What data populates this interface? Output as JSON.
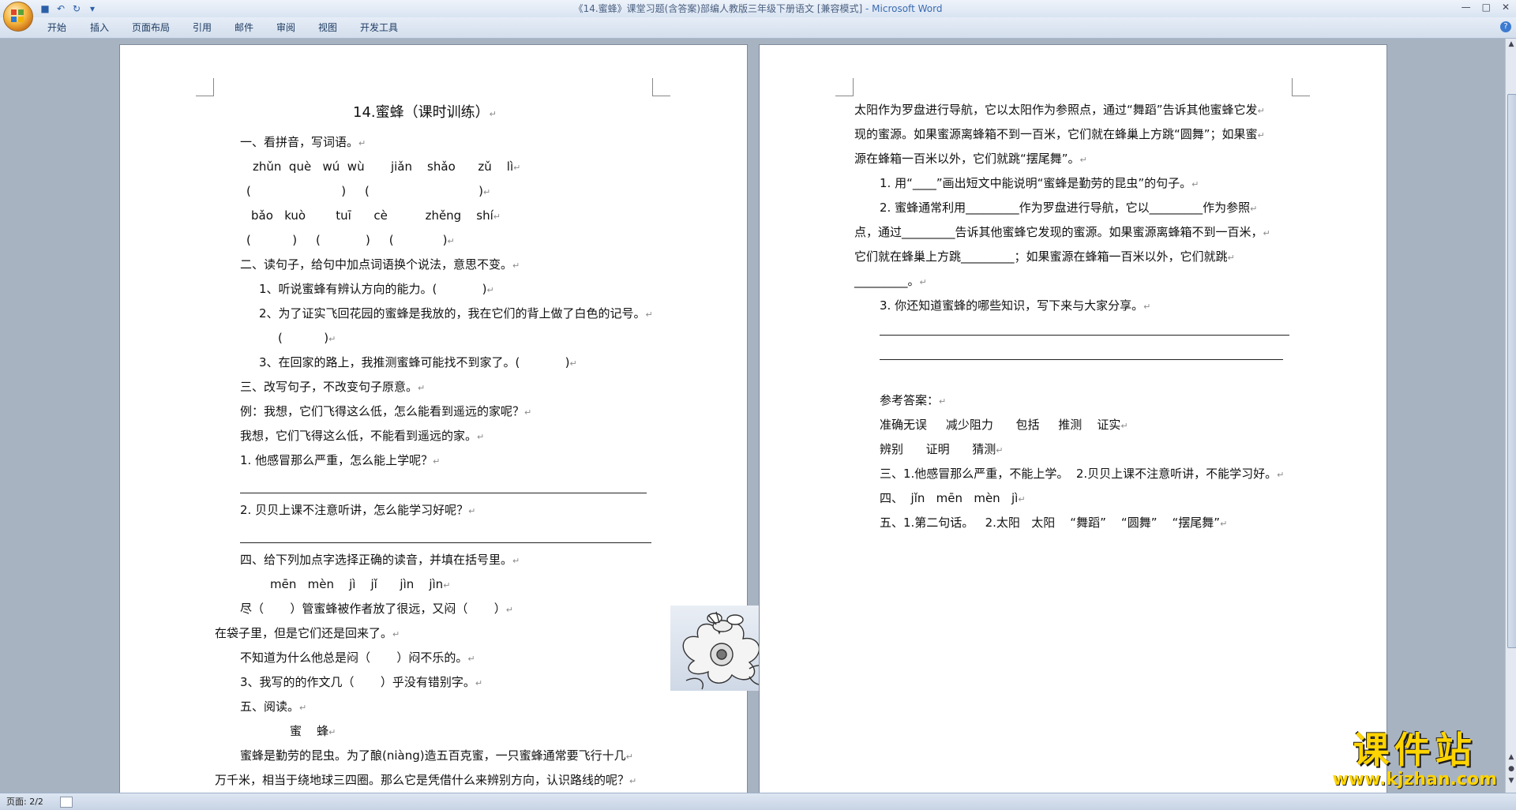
{
  "window": {
    "title": "《14.蜜蜂》课堂习题(含答案)部编人教版三年级下册语文 [兼容模式]",
    "app": " - Microsoft Word",
    "controls": [
      "—",
      "□",
      "✕"
    ]
  },
  "quick_access": [
    {
      "icon": "save-icon",
      "glyph": "■"
    },
    {
      "icon": "undo-icon",
      "glyph": "↶"
    },
    {
      "icon": "redo-icon",
      "glyph": "↻"
    },
    {
      "icon": "customize-icon",
      "glyph": "▾"
    }
  ],
  "ribbon": {
    "tabs": [
      "开始",
      "插入",
      "页面布局",
      "引用",
      "邮件",
      "审阅",
      "视图",
      "开发工具"
    ]
  },
  "page1": {
    "heading": "14.蜜蜂（课时训练）",
    "s1": "一、看拼音，写词语。",
    "py1": "zhǔn  què   wú  wù       jiǎn    shǎo      zǔ    lì",
    "br1": "(                        )     (                             )",
    "py2": "bǎo   kuò        tuī      cè          zhěng    shí",
    "br2": "(           )     (            )     (             )",
    "s2": "二、读句子，给句中加点词语换个说法，意思不变。",
    "s2_1": "1、听说蜜蜂有辨认方向的能力。(            )",
    "s2_2": "2、为了证实飞回花园的蜜蜂是我放的，我在它们的背上做了白色的记号。",
    "s2_2b": "(           )",
    "s2_3": "3、在回家的路上，我推测蜜蜂可能找不到家了。(            )",
    "s3": "三、改写句子，不改变句子原意。",
    "s3_ex": "例：我想，它们飞得这么低，怎么能看到遥远的家呢？",
    "s3_ex2": "我想，它们飞得这么低，不能看到遥远的家。",
    "s3_1": "1. 他感冒那么严重，怎么能上学呢？",
    "s3_2": "2. 贝贝上课不注意听讲，怎么能学习好呢？",
    "s4": "四、给下列加点字选择正确的读音，并填在括号里。",
    "s4_py": "mēn   mèn    jì    jǐ      jìn    jìn",
    "s4_1": "尽（       ）管蜜蜂被作者放了很远，又闷（       ）",
    "s4_1b": "在袋子里，但是它们还是回来了。",
    "s4_2": "不知道为什么他总是闷（       ）闷不乐的。",
    "s4_3": "3、我写的的作文几（       ）乎没有错别字。",
    "s5": "五、阅读。",
    "s5_title": "蜜    蜂",
    "s5_p1": "蜜蜂是勤劳的昆虫。为了酿(niàng)造五百克蜜，一只蜜蜂通常要飞行十几",
    "s5_p2": "万千米，相当于绕地球三四圈。那么它是凭借什么来辨别方向，认识路线的呢？"
  },
  "page2": {
    "p1": "太阳作为罗盘进行导航，它以太阳作为参照点，通过“舞蹈”告诉其他蜜蜂它发",
    "p2": "现的蜜源。如果蜜源离蜂箱不到一百米，它们就在蜂巢上方跳“圆舞”；如果蜜",
    "p3": "源在蜂箱一百米以外，它们就跳“摆尾舞”。",
    "q1": "1. 用“____”画出短文中能说明“蜜蜂是勤劳的昆虫”的句子。",
    "q2a": "2. 蜜蜂通常利用_________作为罗盘进行导航，它以_________作为参照",
    "q2b": "点，通过_________告诉其他蜜蜂它发现的蜜源。如果蜜源离蜂箱不到一百米，",
    "q2c": "它们就在蜂巢上方跳_________；如果蜜源在蜂箱一百米以外，它们就跳",
    "q2d": "_________。",
    "q3": "3. 你还知道蜜蜂的哪些知识，写下来与大家分享。",
    "ans": "参考答案：",
    "a1": "准确无误     减少阻力      包括     推测    证实",
    "a2": "辨别      证明      猜测",
    "a3": "三、1.他感冒那么严重，不能上学。  2.贝贝上课不注意听讲，不能学习好。",
    "a4": "四、  jǐn   mēn   mèn   jì",
    "a5": "五、1.第二句话。   2.太阳   太阳    “舞蹈”    “圆舞”    “摆尾舞”"
  },
  "status": {
    "page": "页面: 2/2"
  },
  "watermark": {
    "big": "课件站",
    "url": "www.kjzhan.com"
  },
  "marks": {
    "para": "↵"
  }
}
